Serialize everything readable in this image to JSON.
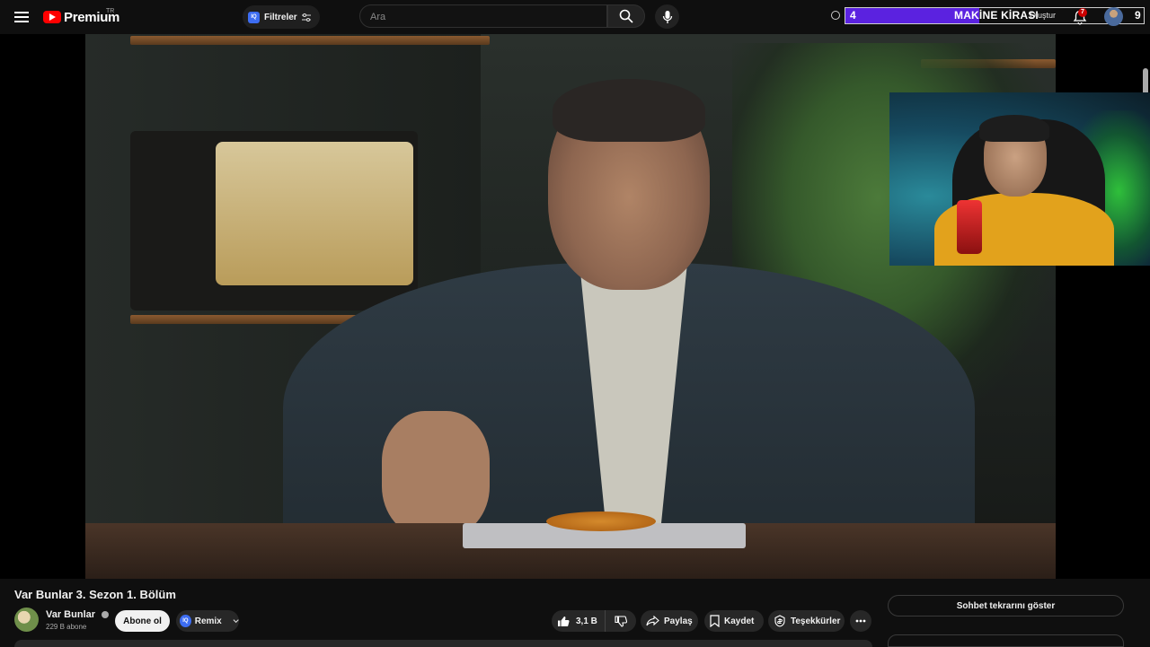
{
  "header": {
    "logo_text": "Premium",
    "region": "TR",
    "filters_badge": "IQ",
    "filters_label": "Filtreler",
    "search_placeholder": "Ara",
    "create_label": "Oluştur",
    "notification_count": "7"
  },
  "overlay": {
    "left_number": "4",
    "title": "MAKİNE KİRASI",
    "right_number": "9",
    "progress": 0.45,
    "fill_color": "#5b22e0"
  },
  "video": {
    "title": "Var Bunlar 3. Sezon 1. Bölüm",
    "channel_name": "Var Bunlar",
    "subscribers": "229 B abone",
    "subscribe_label": "Abone ol",
    "remix_badge": "IQ",
    "remix_label": "Remix",
    "like_count": "3,1 B",
    "share_label": "Paylaş",
    "save_label": "Kaydet",
    "thanks_label": "Teşekkürler"
  },
  "sidebar": {
    "chat_replay_label": "Sohbet tekrarını göster"
  },
  "colors": {
    "background": "#0f0f0f",
    "brand_red": "#ff0000",
    "pill_bg": "#272727"
  },
  "icons": [
    "menu-icon",
    "youtube-logo-icon",
    "filters-icon",
    "search-icon",
    "microphone-icon",
    "clock-icon",
    "bell-icon",
    "like-icon",
    "dislike-icon",
    "share-icon",
    "save-icon",
    "thanks-icon",
    "more-icon",
    "verified-icon",
    "chevron-down-icon"
  ]
}
